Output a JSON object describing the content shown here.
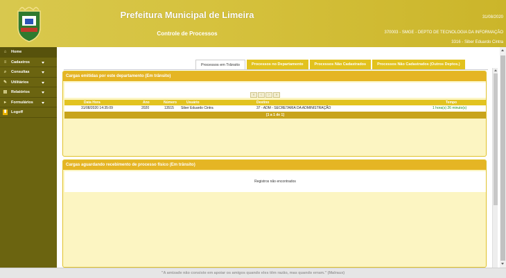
{
  "header": {
    "title": "Prefeitura Municipal de Limeira",
    "subtitle": "Controle de Processos",
    "date": "31/08/2020",
    "department": "370003 - SMGE - DEPTO DE TECNOLOGIA DA INFORMAÇÃO",
    "user": "3316 - Siber Eduardo Cintra"
  },
  "sidebar": {
    "items": [
      {
        "label": "Home",
        "icon": "home-icon",
        "has_arrow": false
      },
      {
        "label": "Cadastros",
        "icon": "list-icon",
        "has_arrow": true
      },
      {
        "label": "Consultas",
        "icon": "search-icon",
        "has_arrow": true
      },
      {
        "label": "Utilitários",
        "icon": "tools-icon",
        "has_arrow": true
      },
      {
        "label": "Relatórios",
        "icon": "report-icon",
        "has_arrow": true
      },
      {
        "label": "Formulários",
        "icon": "form-icon",
        "has_arrow": true
      },
      {
        "label": "Logoff",
        "icon": "logoff-icon",
        "has_arrow": false
      }
    ]
  },
  "tabs": [
    {
      "label": "Processos em Trânsito",
      "active": true
    },
    {
      "label": "Processos no Departamento",
      "active": false
    },
    {
      "label": "Processos Não Cadastrados",
      "active": false
    },
    {
      "label": "Processos Não Cadastrados (Outros Deptos.)",
      "active": false
    }
  ],
  "panel_sent": {
    "title": "Cargas emitidas por este departamento (Em trânsito)",
    "columns": [
      "Data Hora",
      "Ano",
      "Número",
      "Usuário",
      "Destino",
      "Tempo"
    ],
    "rows": [
      {
        "datetime": "31/08/2020 14:35:09",
        "year": "2020",
        "number": "13515",
        "user": "Siber Eduardo Cintra",
        "destination": "37 - ADM - SECRETARIA DA ADMINISTRAÇÃO",
        "time": "1 hora(s) 26 minuto(s)"
      }
    ],
    "pagination": "[1 a 1 de 1]"
  },
  "panel_waiting": {
    "title": "Cargas aguardando recebimento de processo físico (Em trânsito)",
    "empty_message": "Registros não encontrados"
  },
  "footer": {
    "quote": "\"A amizade não consiste em apoiar os amigos quando eles têm razão, mas quando erram.\" (Malraux)"
  },
  "colors": {
    "header_gold": "#d6c23e",
    "sidebar_olive": "#6b6410",
    "tab_yellow": "#e2c21e",
    "panel_header": "#e5b524",
    "panel_bg": "#fcf5c2",
    "time_green": "#1d8f1d"
  }
}
